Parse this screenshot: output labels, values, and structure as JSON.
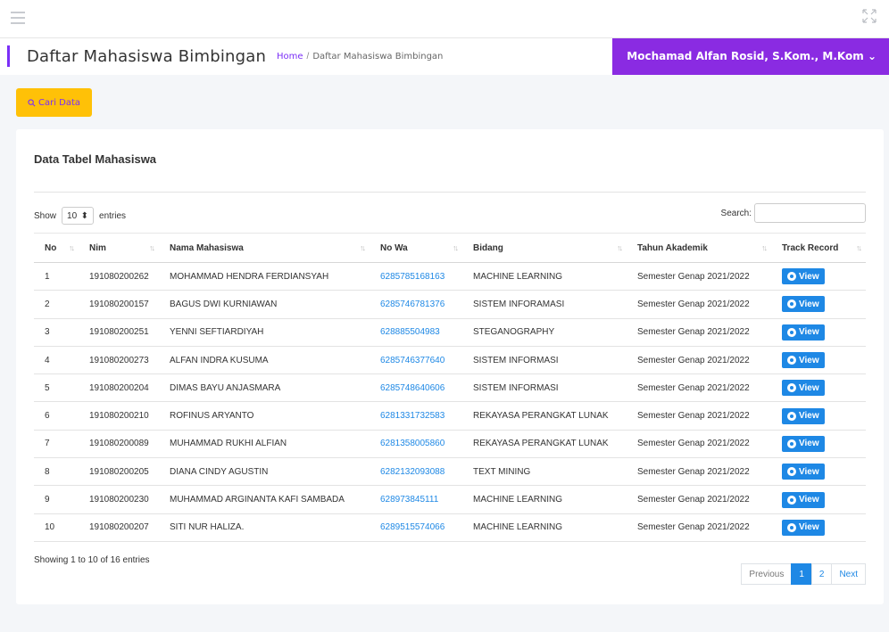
{
  "header": {
    "page_title": "Daftar Mahasiswa Bimbingan",
    "breadcrumb": {
      "home": "Home",
      "separator": "/",
      "current": "Daftar Mahasiswa Bimbingan"
    },
    "user_name": "Mochamad Alfan Rosid, S.Kom., M.Kom",
    "user_chevron": "⌄"
  },
  "toolbar": {
    "search_button": "Cari Data",
    "search_icon": "search-icon"
  },
  "card": {
    "title": "Data Tabel Mahasiswa",
    "show_label": "Show",
    "entries_value": "10",
    "entries_label": "entries",
    "search_label": "Search:",
    "search_value": ""
  },
  "table": {
    "columns": [
      "No",
      "Nim",
      "Nama Mahasiswa",
      "No Wa",
      "Bidang",
      "Tahun Akademik",
      "Track Record"
    ],
    "view_label": "View",
    "rows": [
      {
        "no": "1",
        "nim": "191080200262",
        "nama": "MOHAMMAD HENDRA FERDIANSYAH",
        "wa": "6285785168163",
        "bidang": "MACHINE LEARNING",
        "tahun": "Semester Genap 2021/2022"
      },
      {
        "no": "2",
        "nim": "191080200157",
        "nama": "BAGUS DWI KURNIAWAN",
        "wa": "6285746781376",
        "bidang": "SISTEM INFORAMASI",
        "tahun": "Semester Genap 2021/2022"
      },
      {
        "no": "3",
        "nim": "191080200251",
        "nama": "YENNI SEFTIARDIYAH",
        "wa": "628885504983",
        "bidang": "STEGANOGRAPHY",
        "tahun": "Semester Genap 2021/2022"
      },
      {
        "no": "4",
        "nim": "191080200273",
        "nama": "ALFAN INDRA KUSUMA",
        "wa": "6285746377640",
        "bidang": "SISTEM INFORMASI",
        "tahun": "Semester Genap 2021/2022"
      },
      {
        "no": "5",
        "nim": "191080200204",
        "nama": "DIMAS BAYU ANJASMARA",
        "wa": "6285748640606",
        "bidang": "SISTEM INFORMASI",
        "tahun": "Semester Genap 2021/2022"
      },
      {
        "no": "6",
        "nim": "191080200210",
        "nama": "ROFINUS ARYANTO",
        "wa": "6281331732583",
        "bidang": "REKAYASA PERANGKAT LUNAK",
        "tahun": "Semester Genap 2021/2022"
      },
      {
        "no": "7",
        "nim": "191080200089",
        "nama": "MUHAMMAD RUKHI ALFIAN",
        "wa": "6281358005860",
        "bidang": "REKAYASA PERANGKAT LUNAK",
        "tahun": "Semester Genap 2021/2022"
      },
      {
        "no": "8",
        "nim": "191080200205",
        "nama": "DIANA CINDY AGUSTIN",
        "wa": "6282132093088",
        "bidang": "TEXT MINING",
        "tahun": "Semester Genap 2021/2022"
      },
      {
        "no": "9",
        "nim": "191080200230",
        "nama": "MUHAMMAD ARGINANTA KAFI SAMBADA",
        "wa": "628973845111",
        "bidang": "MACHINE LEARNING",
        "tahun": "Semester Genap 2021/2022"
      },
      {
        "no": "10",
        "nim": "191080200207",
        "nama": "SITI NUR HALIZA.",
        "wa": "6289515574066",
        "bidang": "MACHINE LEARNING",
        "tahun": "Semester Genap 2021/2022"
      }
    ]
  },
  "footer": {
    "info": "Showing 1 to 10 of 16 entries",
    "pagination": [
      "Previous",
      "1",
      "2",
      "Next"
    ]
  },
  "colors": {
    "accent": "#8a2be2",
    "primary": "#1e88e5",
    "warning": "#ffc107"
  }
}
